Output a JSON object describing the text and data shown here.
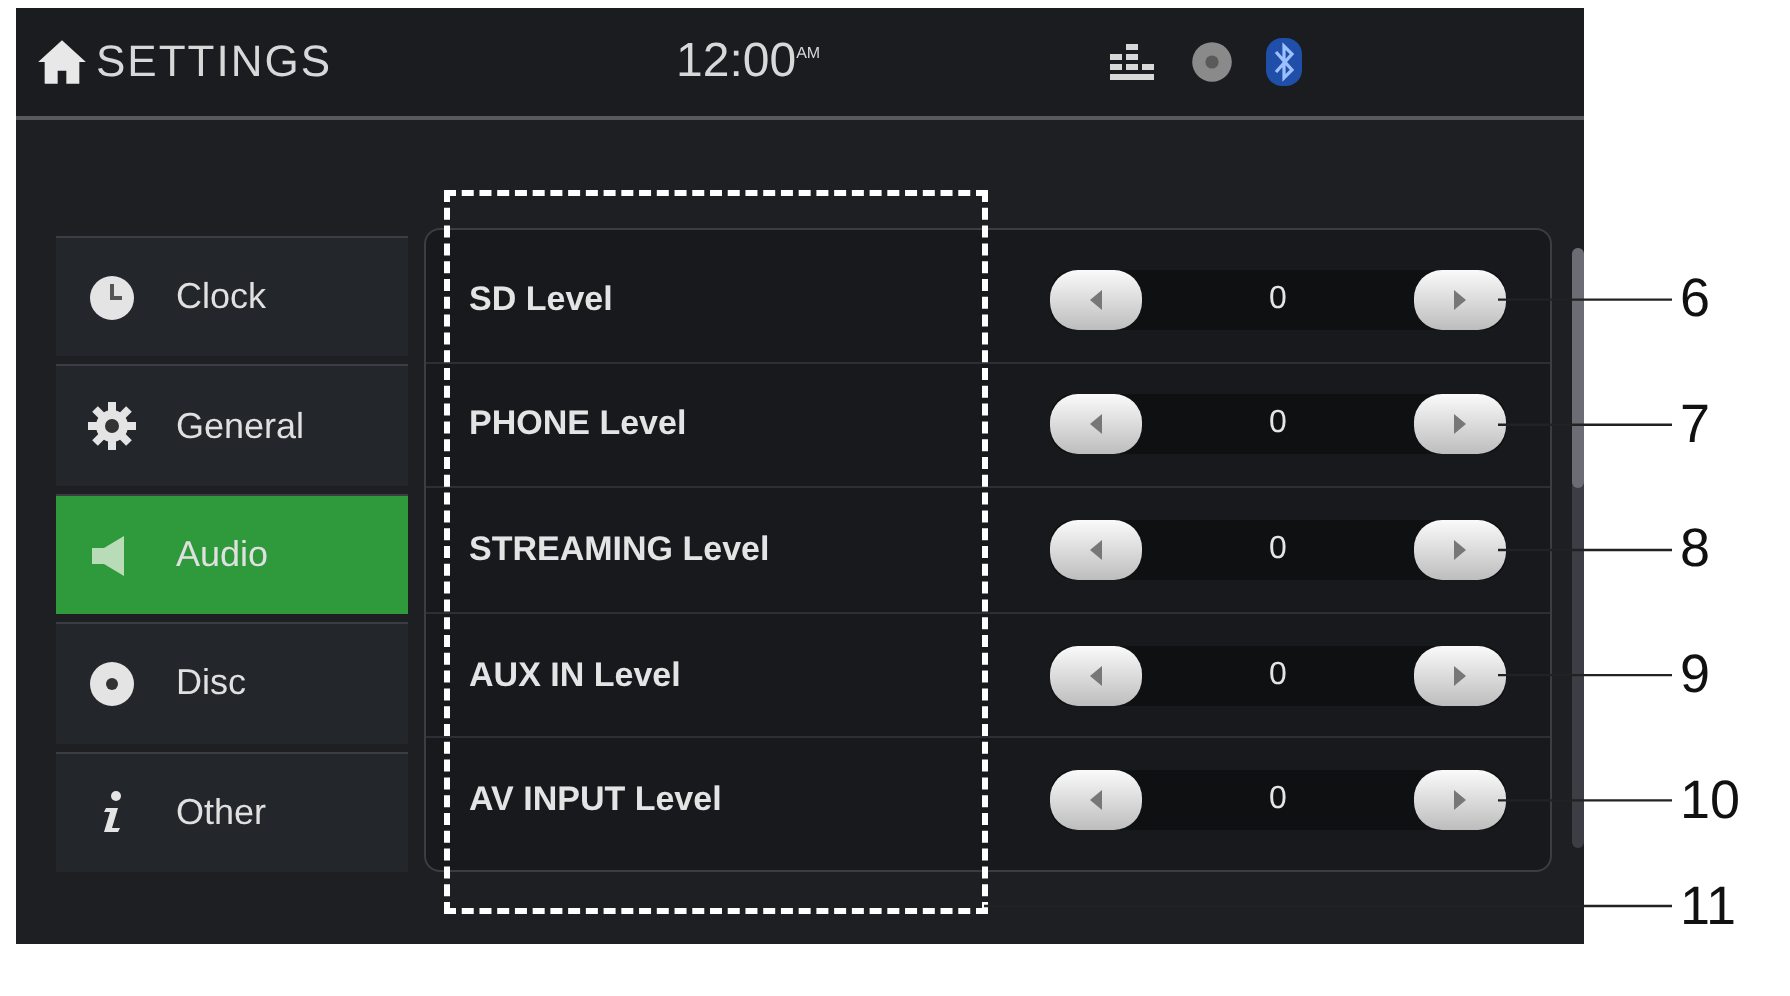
{
  "header": {
    "title": "SETTINGS",
    "time": "12:00$^{AM}$"
  },
  "sidebar": {
    "items": [
      {
        "label": "Clock",
        "kind": "clock",
        "selected": false
      },
      {
        "label": "General",
        "kind": "gear",
        "selected": false
      },
      {
        "label": "Audio",
        "kind": "speaker",
        "selected": true
      },
      {
        "label": "Disc",
        "kind": "disc",
        "selected": false
      },
      {
        "label": "Other",
        "kind": "info",
        "selected": false
      }
    ]
  },
  "rows": [
    {
      "label": "SD Level",
      "value": "0"
    },
    {
      "label": "PHONE Level",
      "value": "0"
    },
    {
      "label": "STREAMING Level",
      "value": "0"
    },
    {
      "label": "AUX IN Level",
      "value": "0"
    },
    {
      "label": "AV INPUT Level",
      "value": "0"
    }
  ],
  "callouts": [
    {
      "label": "6",
      "kind": "row"
    },
    {
      "label": "7",
      "kind": "row"
    },
    {
      "label": "8",
      "kind": "row"
    },
    {
      "label": "9",
      "kind": "row"
    },
    {
      "label": "10",
      "kind": "row"
    },
    {
      "label": "11",
      "kind": "frame"
    }
  ]
}
